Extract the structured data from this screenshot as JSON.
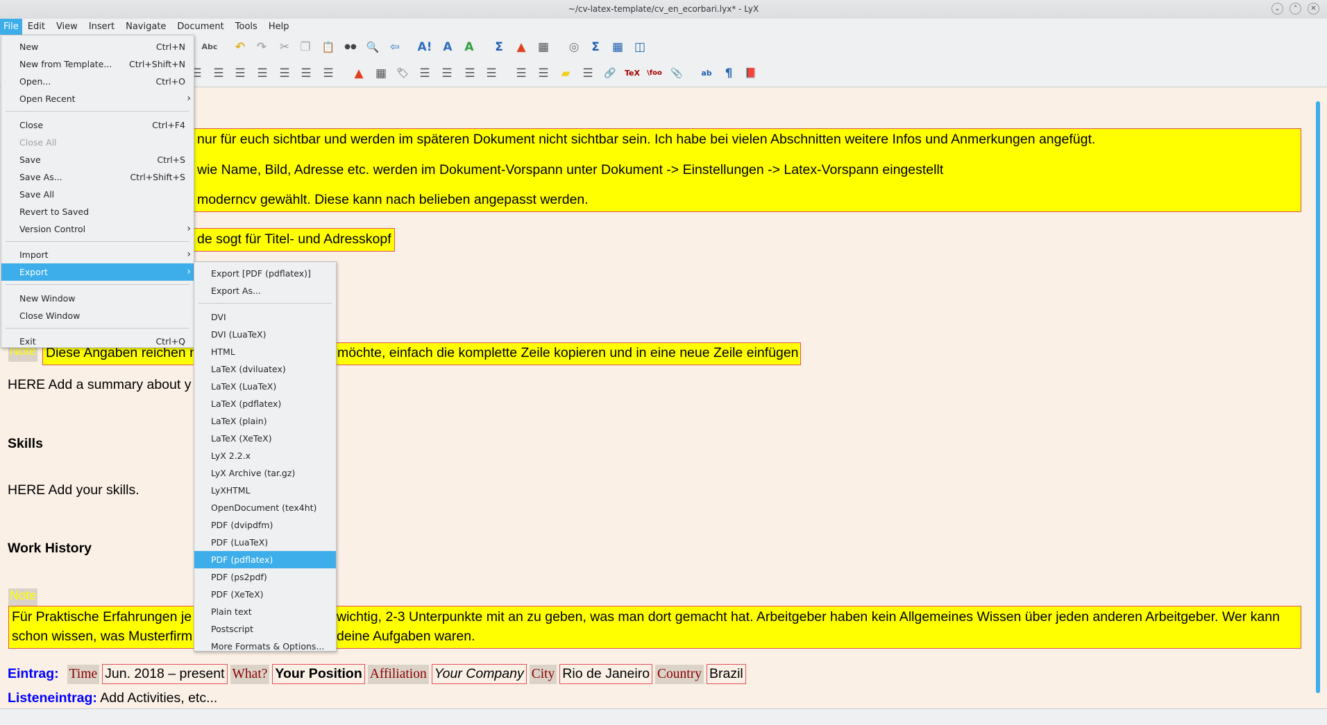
{
  "window": {
    "title": "~/cv-latex-template/cv_en_ecorbari.lyx* - LyX",
    "controls": [
      "minimize",
      "maximize",
      "close"
    ]
  },
  "menubar": [
    "File",
    "Edit",
    "View",
    "Insert",
    "Navigate",
    "Document",
    "Tools",
    "Help"
  ],
  "toolbar": {
    "row1": [
      "spellcheck-icon",
      "undo-icon",
      "redo-icon",
      "cut-icon",
      "copy-icon",
      "paste-icon",
      "find-binoculars-icon",
      "find-replace-icon",
      "navigate-back-icon",
      "text-style-icon",
      "text-style-person-icon",
      "change-tracking-icon",
      "math-icon",
      "insert-graphics-icon",
      "insert-table-icon",
      "navigator-icon",
      "math-panel-icon",
      "table-panel-icon",
      "view-panel-icon"
    ],
    "row2": [
      "paragraph-align-icon",
      "numbered-list-icon",
      "bullet-list-icon",
      "description-list-icon",
      "enumerate-list-icon",
      "decrease-depth-icon",
      "increase-depth-icon",
      "insert-figure-icon",
      "insert-table-float-icon",
      "label-icon",
      "cross-reference-icon",
      "include-file-icon",
      "index-entry-icon",
      "nomenclature-icon",
      "footnote-icon",
      "marginal-note-icon",
      "note-icon",
      "box-icon",
      "hyperlink-icon",
      "tex-code-icon",
      "citation-icon",
      "attachment-icon",
      "character-icon",
      "paragraph-settings-icon",
      "bibliography-icon"
    ]
  },
  "file_menu": {
    "items": [
      {
        "label": "New",
        "shortcut": "Ctrl+N"
      },
      {
        "label": "New from Template...",
        "shortcut": "Ctrl+Shift+N"
      },
      {
        "label": "Open...",
        "shortcut": "Ctrl+O"
      },
      {
        "label": "Open Recent",
        "submenu": true
      },
      {
        "sep": true
      },
      {
        "label": "Close",
        "shortcut": "Ctrl+F4"
      },
      {
        "label": "Close All",
        "disabled": true
      },
      {
        "label": "Save",
        "shortcut": "Ctrl+S"
      },
      {
        "label": "Save As...",
        "shortcut": "Ctrl+Shift+S"
      },
      {
        "label": "Save All"
      },
      {
        "label": "Revert to Saved"
      },
      {
        "label": "Version Control",
        "submenu": true
      },
      {
        "sep": true
      },
      {
        "label": "Import",
        "submenu": true
      },
      {
        "label": "Export",
        "submenu": true,
        "highlighted": true
      },
      {
        "sep": true
      },
      {
        "label": "New Window"
      },
      {
        "label": "Close Window"
      },
      {
        "sep": true
      },
      {
        "label": "Exit",
        "shortcut": "Ctrl+Q"
      }
    ]
  },
  "export_menu": {
    "items": [
      {
        "label": "Export [PDF (pdflatex)]"
      },
      {
        "label": "Export As..."
      },
      {
        "sep": true
      },
      {
        "label": "DVI"
      },
      {
        "label": "DVI (LuaTeX)"
      },
      {
        "label": "HTML"
      },
      {
        "label": "LaTeX (dviluatex)"
      },
      {
        "label": "LaTeX (LuaTeX)"
      },
      {
        "label": "LaTeX (pdflatex)"
      },
      {
        "label": "LaTeX (plain)"
      },
      {
        "label": "LaTeX (XeTeX)"
      },
      {
        "label": "LyX 2.2.x"
      },
      {
        "label": "LyX Archive (tar.gz)"
      },
      {
        "label": "LyXHTML"
      },
      {
        "label": "OpenDocument (tex4ht)"
      },
      {
        "label": "PDF (dvipdfm)"
      },
      {
        "label": "PDF (LuaTeX)"
      },
      {
        "label": "PDF (pdflatex)",
        "highlighted": true
      },
      {
        "label": "PDF (ps2pdf)"
      },
      {
        "label": "PDF (XeTeX)"
      },
      {
        "label": "Plain text"
      },
      {
        "label": "Postscript"
      },
      {
        "label": "More Formats & Options..."
      }
    ]
  },
  "document": {
    "note1": [
      "nur für euch sichtbar und werden im späteren Dokument nicht sichtbar sein. Ich habe bei vielen Abschnitten weitere Infos und Anmerkungen angefügt.",
      "wie Name, Bild, Adresse etc. werden im Dokument-Vorspann unter Dokument -> Einstellungen -> Latex-Vorspann eingestellt",
      "moderncv gewählt. Diese kann nach belieben angepasst werden."
    ],
    "note2": "de sogt für Titel- und Adresskopf",
    "note_label": "Note",
    "note3_left": "Diese Angaben reichen n",
    "note3_right": "möchte, einfach die komplette Zeile kopieren und in eine neue Zeile einfügen",
    "summary": "HERE Add a summary about y",
    "skills_heading": "Skills",
    "skills_text": "HERE Add your skills.",
    "work_heading": "Work History",
    "note4_line1_left": "Für Praktische Erfahrungen je",
    "note4_line1_right": "wichtig, 2-3 Unterpunkte mit an zu geben, was man dort gemacht hat. Arbeitgeber haben kein Allgemeines Wissen über jeden anderen Arbeitgeber. Wer kann",
    "note4_line2_left": "schon wissen, was Musterfirm",
    "note4_line2_right": "deine Aufgaben waren.",
    "entry": {
      "label": "Eintrag:",
      "fields": [
        {
          "label": "Time",
          "value": "Jun. 2018 – present",
          "style": "normal"
        },
        {
          "label": "What?",
          "value": "Your Position",
          "style": "bold"
        },
        {
          "label": "Affiliation",
          "value": "Your Company",
          "style": "italic"
        },
        {
          "label": "City",
          "value": "Rio de Janeiro",
          "style": "normal"
        },
        {
          "label": "Country",
          "value": "Brazil",
          "style": "normal"
        }
      ]
    },
    "list_entry": {
      "label": "Listeneintrag:",
      "value": "Add Activities, etc..."
    }
  },
  "colors": {
    "accent": "#3daee9",
    "note_bg": "#ffff00",
    "note_border": "#e0525a",
    "doc_bg": "#faf0e6",
    "label_blue": "#0000ff",
    "field_label": "#8b0000"
  }
}
